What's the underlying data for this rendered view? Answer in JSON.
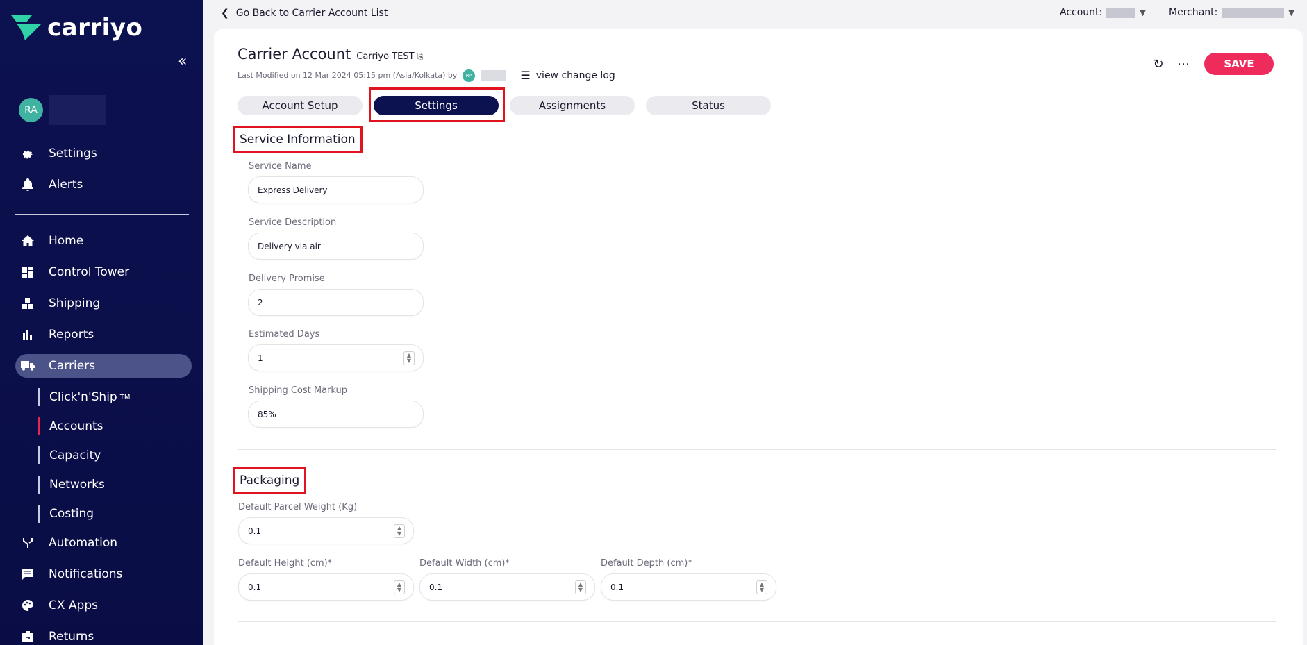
{
  "brand": {
    "logo_text": "carriyo"
  },
  "user": {
    "initials": "RA"
  },
  "sidebar": {
    "top_items": [
      {
        "label": "Settings",
        "icon": "gear-icon"
      },
      {
        "label": "Alerts",
        "icon": "bell-icon"
      }
    ],
    "items": [
      {
        "label": "Home",
        "icon": "home-icon"
      },
      {
        "label": "Control Tower",
        "icon": "dashboard-icon"
      },
      {
        "label": "Shipping",
        "icon": "boxes-icon"
      },
      {
        "label": "Reports",
        "icon": "bar-chart-icon"
      },
      {
        "label": "Carriers",
        "icon": "truck-icon"
      }
    ],
    "carrier_sub": [
      {
        "label": "Click'n'Ship",
        "tm": "TM"
      },
      {
        "label": "Accounts"
      },
      {
        "label": "Capacity"
      },
      {
        "label": "Networks"
      },
      {
        "label": "Costing"
      }
    ],
    "bottom_items": [
      {
        "label": "Automation",
        "icon": "fork-icon"
      },
      {
        "label": "Notifications",
        "icon": "message-icon"
      },
      {
        "label": "CX Apps",
        "icon": "palette-icon"
      },
      {
        "label": "Returns",
        "icon": "returns-icon"
      }
    ]
  },
  "topbar": {
    "back_label": "Go Back to Carrier Account List",
    "account_label": "Account:",
    "merchant_label": "Merchant:"
  },
  "header": {
    "title": "Carrier Account",
    "subtitle": "Carriyo TEST",
    "modified": "Last Modified on 12 Mar 2024 05:15 pm (Asia/Kolkata) by",
    "modifier_initials": "RA",
    "change_log": "view change log",
    "save_label": "SAVE"
  },
  "tabs": [
    "Account Setup",
    "Settings",
    "Assignments",
    "Status"
  ],
  "service": {
    "title": "Service Information",
    "fields": [
      {
        "label": "Service Name",
        "value": "Express Delivery"
      },
      {
        "label": "Service Description",
        "value": "Delivery via air"
      },
      {
        "label": "Delivery Promise",
        "value": "2"
      },
      {
        "label": "Estimated Days",
        "value": "1"
      },
      {
        "label": "Shipping Cost Markup",
        "value": "85%"
      }
    ]
  },
  "packaging": {
    "title": "Packaging",
    "weight": {
      "label": "Default Parcel Weight (Kg)",
      "value": "0.1"
    },
    "height": {
      "label": "Default Height (cm)*",
      "value": "0.1"
    },
    "width": {
      "label": "Default Width (cm)*",
      "value": "0.1"
    },
    "depth": {
      "label": "Default Depth (cm)*",
      "value": "0.1"
    }
  },
  "colors": {
    "sidebar_bg": "#0c1150",
    "accent": "#ef2b5b",
    "highlight": "#e0141e",
    "avatar": "#3fb2a2"
  }
}
